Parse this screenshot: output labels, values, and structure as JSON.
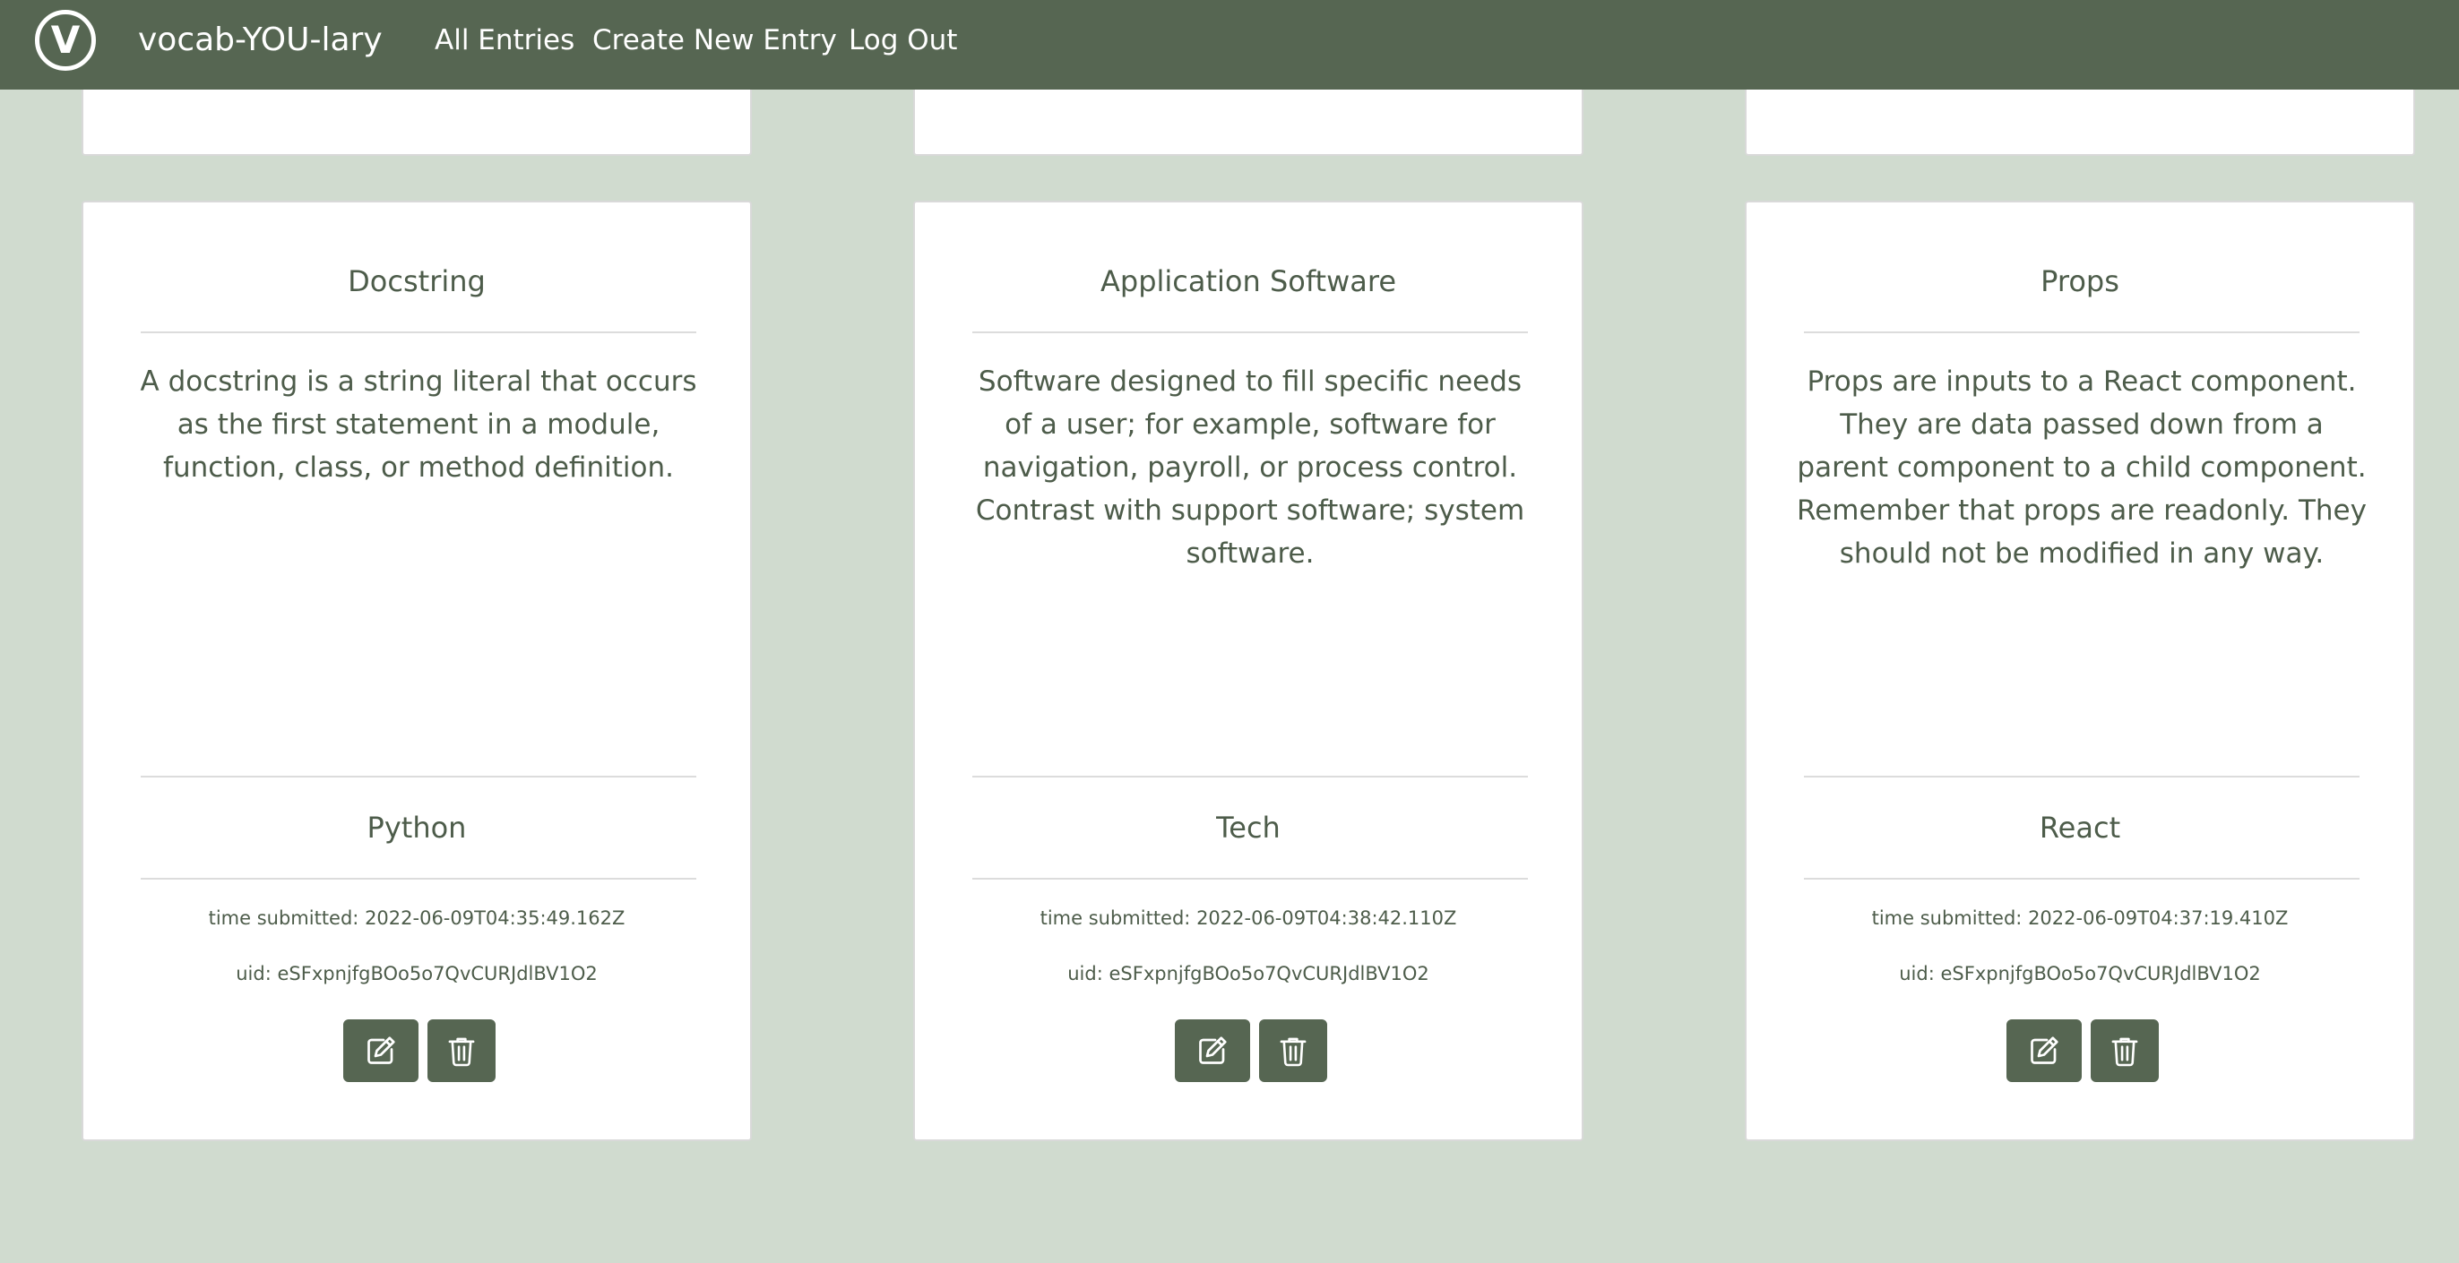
{
  "nav": {
    "logo_letter": "V",
    "brand": "vocab-YOU-lary",
    "links": [
      "All Entries",
      "Create New Entry",
      "Log Out"
    ]
  },
  "labels": {
    "time_prefix": "time submitted: ",
    "uid_prefix": "uid: "
  },
  "cards": [
    {
      "word": "Docstring",
      "definition": "A docstring is a string literal that occurs as the first statement in a module, function, class, or method definition.",
      "category": "Python",
      "time": "2022-06-09T04:35:49.162Z",
      "uid": "eSFxpnjfgBOo5o7QvCURJdlBV1O2"
    },
    {
      "word": "Application Software",
      "definition": "Software designed to fill specific needs of a user; for example, software for navigation, payroll, or process control. Contrast with support software; system software.",
      "category": "Tech",
      "time": "2022-06-09T04:38:42.110Z",
      "uid": "eSFxpnjfgBOo5o7QvCURJdlBV1O2"
    },
    {
      "word": "Props",
      "definition": "Props are inputs to a React component. They are data passed down from a parent component to a child component. Remember that props are readonly. They should not be modified in any way.",
      "category": "React",
      "time": "2022-06-09T04:37:19.410Z",
      "uid": "eSFxpnjfgBOo5o7QvCURJdlBV1O2"
    }
  ],
  "icons": {
    "edit": "edit-icon",
    "delete": "trash-icon"
  },
  "colors": {
    "navbar": "#566652",
    "background": "#d0dbcf",
    "button": "#566652",
    "text": "#4d5c4a"
  }
}
